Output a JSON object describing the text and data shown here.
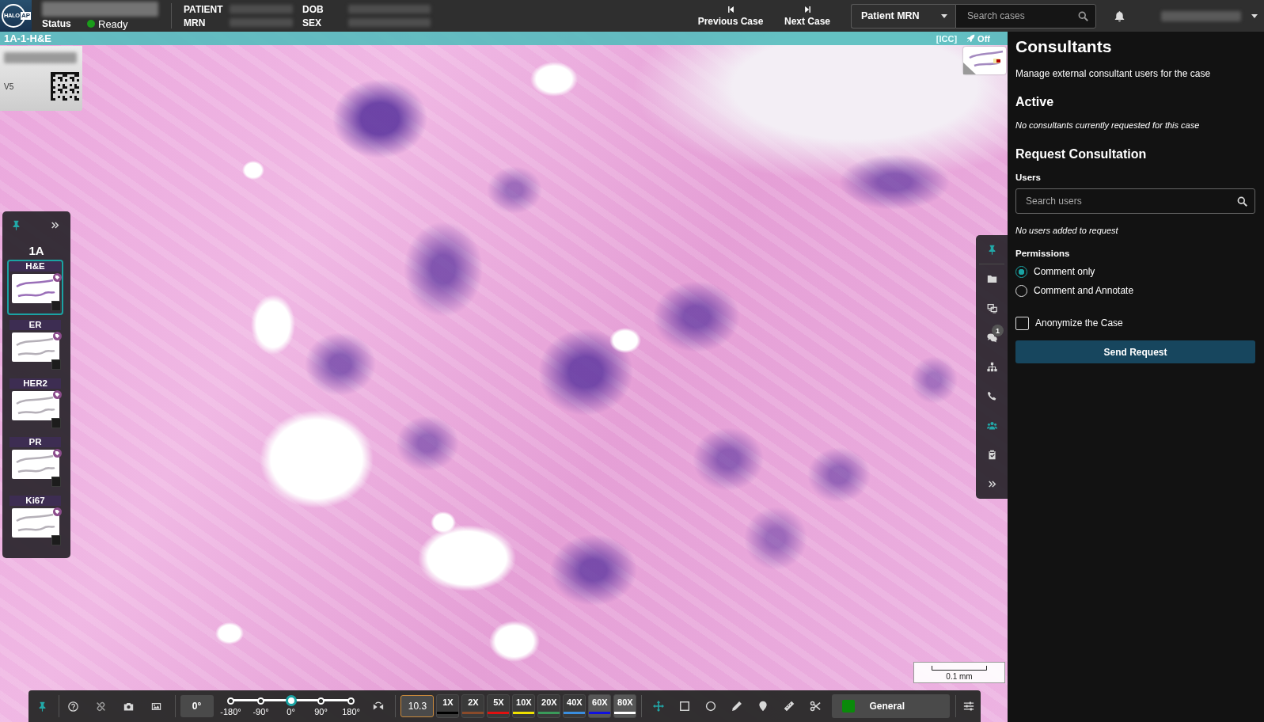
{
  "header": {
    "logo": {
      "name": "HALO",
      "suffix": "AP"
    },
    "status": {
      "label": "Status",
      "value": "Ready",
      "color": "#1a9c1a"
    },
    "patient_info": [
      {
        "label": "PATIENT"
      },
      {
        "label": "MRN"
      },
      {
        "label": "DOB"
      },
      {
        "label": "SEX"
      }
    ],
    "navigation": [
      {
        "kind": "previous",
        "label": "Previous Case"
      },
      {
        "kind": "next",
        "label": "Next Case"
      }
    ],
    "search": {
      "scope": "Patient MRN",
      "placeholder": "Search cases"
    }
  },
  "viewer": {
    "slide_title": "1A-1-H&E",
    "icc": "[ICC]",
    "boost": "Off",
    "slide_label": {
      "version": "V5"
    },
    "scale_bar": "0.1 mm",
    "slide_panel": {
      "pinned": true,
      "block": "1A",
      "slides": [
        {
          "stain": "H&E",
          "selected": true,
          "checked": false
        },
        {
          "stain": "ER",
          "selected": false,
          "checked": false
        },
        {
          "stain": "HER2",
          "selected": false,
          "checked": false
        },
        {
          "stain": "PR",
          "selected": false,
          "checked": false
        },
        {
          "stain": "Ki67",
          "selected": false,
          "checked": false
        }
      ]
    },
    "side_toolbar": {
      "pinned": true,
      "items": [
        {
          "kind": "folder",
          "selected": false
        },
        {
          "kind": "screens",
          "selected": false
        },
        {
          "kind": "comments",
          "selected": false,
          "badge": "1"
        },
        {
          "kind": "hierarchy",
          "selected": false
        },
        {
          "kind": "phone",
          "selected": false
        },
        {
          "kind": "consultants",
          "selected": true
        },
        {
          "kind": "clipboard",
          "selected": false
        }
      ]
    },
    "toolbar": {
      "pinned": true,
      "rotation": "0°",
      "rotation_slider": {
        "level": 0.5,
        "ticks": [
          "-180°",
          "-90°",
          "0°",
          "90°",
          "180°"
        ]
      },
      "zoom": "10.3",
      "magnifications": [
        {
          "label": "1X",
          "color": "#000000",
          "shaded": false
        },
        {
          "label": "2X",
          "color": "#8a4a2a",
          "shaded": false
        },
        {
          "label": "5X",
          "color": "#e01010",
          "shaded": false
        },
        {
          "label": "10X",
          "color": "#f0e000",
          "shaded": false
        },
        {
          "label": "20X",
          "color": "#3a9a5a",
          "shaded": false
        },
        {
          "label": "40X",
          "color": "#3a8ee0",
          "shaded": false
        },
        {
          "label": "60X",
          "color": "#1010e0",
          "shaded": true
        },
        {
          "label": "80X",
          "color": "#ffffff",
          "shaded": true
        }
      ],
      "tools": [
        {
          "kind": "pan",
          "selected": true
        },
        {
          "kind": "rectangle",
          "selected": false
        },
        {
          "kind": "ellipse",
          "selected": false
        },
        {
          "kind": "pencil",
          "selected": false
        },
        {
          "kind": "marker",
          "selected": false
        },
        {
          "kind": "ruler",
          "selected": false
        },
        {
          "kind": "scissors",
          "selected": false
        }
      ],
      "annotation_class": {
        "label": "General",
        "color": "#0a8a0a"
      }
    }
  },
  "consultants_panel": {
    "title": "Consultants",
    "description": "Manage external consultant users for the case",
    "active": {
      "heading": "Active",
      "empty": "No consultants currently requested for this case"
    },
    "request": {
      "heading": "Request Consultation",
      "users_label": "Users",
      "users_placeholder": "Search users",
      "users_empty": "No users added to request",
      "permissions_label": "Permissions",
      "permissions": [
        {
          "label": "Comment only",
          "selected": true
        },
        {
          "label": "Comment and Annotate",
          "selected": false
        }
      ],
      "anonymize": {
        "label": "Anonymize the Case",
        "checked": false
      },
      "submit": "Send Request"
    }
  }
}
